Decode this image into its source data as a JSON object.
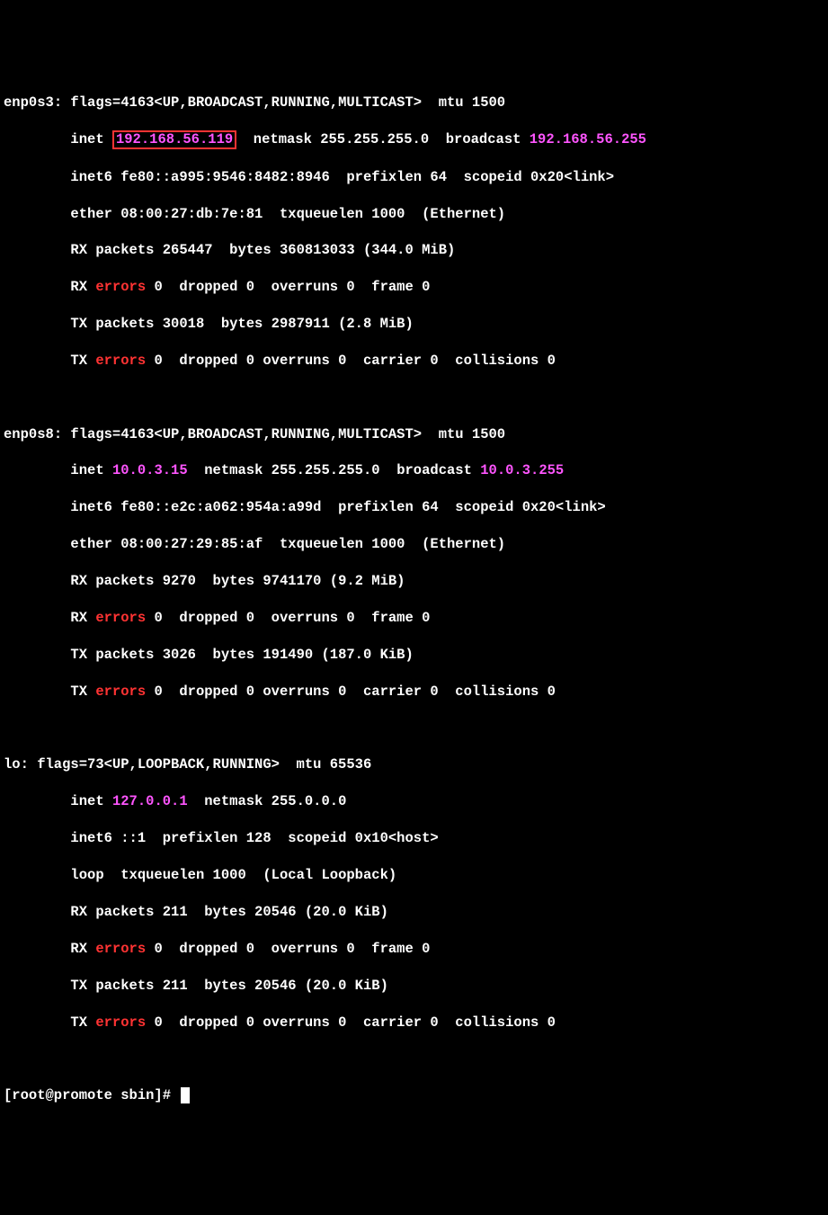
{
  "interfaces": [
    {
      "name": "enp0s3",
      "flags_line": "flags=4163<UP,BROADCAST,RUNNING,MULTICAST>  mtu 1500",
      "inet_label": "inet",
      "inet_addr": "192.168.56.119",
      "inet_rest": "  netmask 255.255.255.0  broadcast ",
      "broadcast": "192.168.56.255",
      "inet6_line": "inet6 fe80::a995:9546:8482:8946  prefixlen 64  scopeid 0x20<link>",
      "ether_line": "ether 08:00:27:db:7e:81  txqueuelen 1000  (Ethernet)",
      "rx_packets": "RX packets 265447  bytes 360813033 (344.0 MiB)",
      "rx_err_prefix": "RX ",
      "rx_err_word": "errors",
      "rx_err_rest": " 0  dropped 0  overruns 0  frame 0",
      "tx_packets": "TX packets 30018  bytes 2987911 (2.8 MiB)",
      "tx_err_prefix": "TX ",
      "tx_err_word": "errors",
      "tx_err_rest": " 0  dropped 0 overruns 0  carrier 0  collisions 0",
      "highlighted": true
    },
    {
      "name": "enp0s8",
      "flags_line": "flags=4163<UP,BROADCAST,RUNNING,MULTICAST>  mtu 1500",
      "inet_label": "inet ",
      "inet_addr": "10.0.3.15",
      "inet_rest": "  netmask 255.255.255.0  broadcast ",
      "broadcast": "10.0.3.255",
      "inet6_line": "inet6 fe80::e2c:a062:954a:a99d  prefixlen 64  scopeid 0x20<link>",
      "ether_line": "ether 08:00:27:29:85:af  txqueuelen 1000  (Ethernet)",
      "rx_packets": "RX packets 9270  bytes 9741170 (9.2 MiB)",
      "rx_err_prefix": "RX ",
      "rx_err_word": "errors",
      "rx_err_rest": " 0  dropped 0  overruns 0  frame 0",
      "tx_packets": "TX packets 3026  bytes 191490 (187.0 KiB)",
      "tx_err_prefix": "TX ",
      "tx_err_word": "errors",
      "tx_err_rest": " 0  dropped 0 overruns 0  carrier 0  collisions 0",
      "highlighted": false
    }
  ],
  "lo": {
    "header": "lo: flags=73<UP,LOOPBACK,RUNNING>  mtu 65536",
    "inet_label": "inet ",
    "inet_addr": "127.0.0.1",
    "inet_rest": "  netmask 255.0.0.0",
    "inet6_line": "inet6 ::1  prefixlen 128  scopeid 0x10<host>",
    "loop_line": "loop  txqueuelen 1000  (Local Loopback)",
    "rx_packets": "RX packets 211  bytes 20546 (20.0 KiB)",
    "rx_err_prefix": "RX ",
    "rx_err_word": "errors",
    "rx_err_rest": " 0  dropped 0  overruns 0  frame 0",
    "tx_packets": "TX packets 211  bytes 20546 (20.0 KiB)",
    "tx_err_prefix": "TX ",
    "tx_err_word": "errors",
    "tx_err_rest": " 0  dropped 0 overruns 0  carrier 0  collisions 0"
  },
  "prompt": {
    "text": "[root@promote sbin]# "
  },
  "indent": "        "
}
